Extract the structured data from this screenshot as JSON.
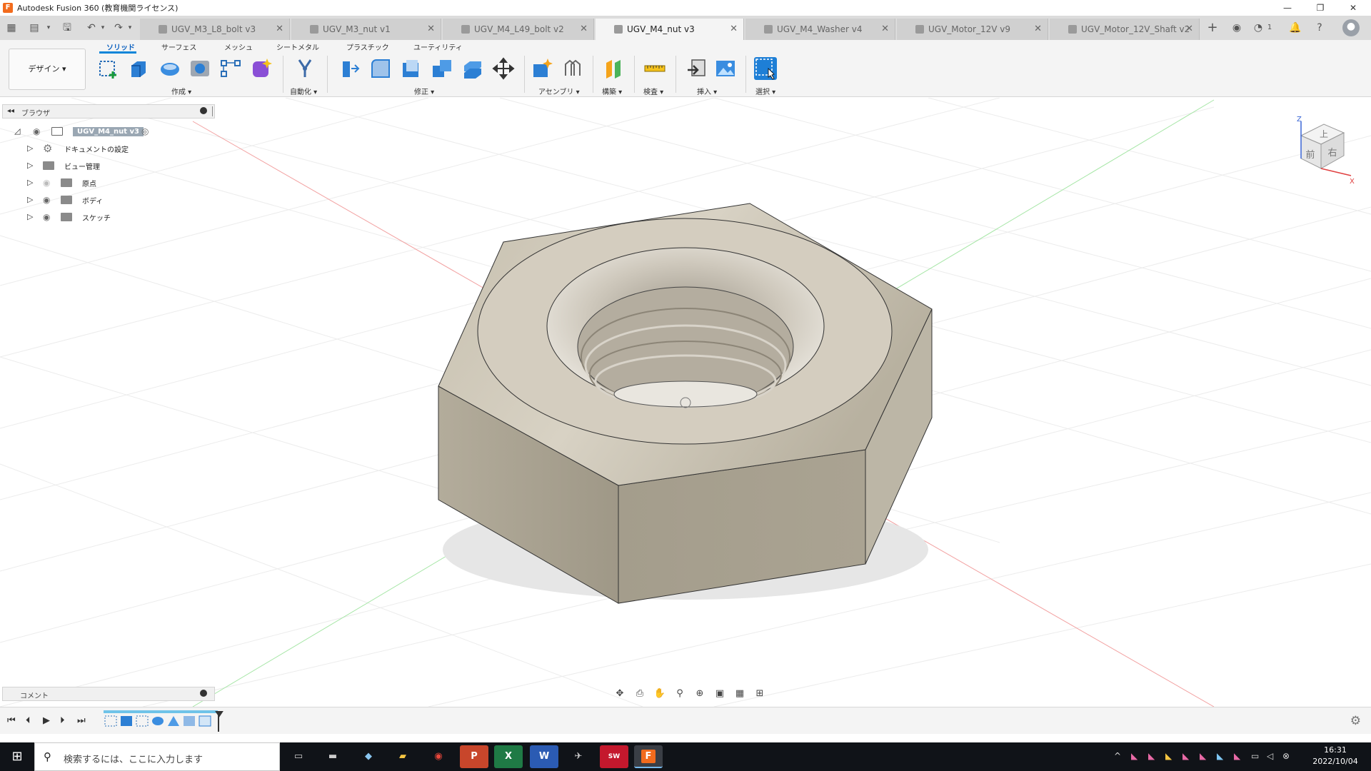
{
  "window": {
    "title": "Autodesk Fusion 360 (教育機関ライセンス)",
    "minimize": "—",
    "restore": "❐",
    "close": "✕"
  },
  "tabs": [
    {
      "label": "UGV_M3_L8_bolt v3",
      "active": false
    },
    {
      "label": "UGV_M3_nut v1",
      "active": false
    },
    {
      "label": "UGV_M4_L49_bolt v2",
      "active": false
    },
    {
      "label": "UGV_M4_nut v3",
      "active": true
    },
    {
      "label": "UGV_M4_Washer v4",
      "active": false
    },
    {
      "label": "UGV_Motor_12V v9",
      "active": false
    },
    {
      "label": "UGV_Motor_12V_Shaft v2",
      "active": false
    }
  ],
  "tabbar_right": {
    "job_count": "1"
  },
  "ribbon": {
    "workspace": "デザイン",
    "tabs": [
      "ソリッド",
      "サーフェス",
      "メッシュ",
      "シートメタル",
      "プラスチック",
      "ユーティリティ"
    ],
    "groups": [
      "作成",
      "自動化",
      "修正",
      "アセンブリ",
      "構築",
      "検査",
      "挿入",
      "選択"
    ]
  },
  "browser": {
    "header": "ブラウザ",
    "root": "UGV_M4_nut v3",
    "items": [
      "ドキュメントの設定",
      "ビュー管理",
      "原点",
      "ボディ",
      "スケッチ"
    ]
  },
  "viewcube": {
    "top": "上",
    "front": "前",
    "right": "右",
    "axis_z": "Z",
    "axis_x": "X"
  },
  "comments": {
    "label": "コメント"
  },
  "taskbar": {
    "search_placeholder": "検索するには、ここに入力します",
    "apps": [
      "Files",
      "Terminal",
      "Edit",
      "Explorer",
      "Chrome",
      "P",
      "X",
      "W",
      "Tools",
      "SW 2019",
      "F"
    ],
    "time": "16:31",
    "date": "2022/10/04"
  },
  "colors": {
    "accent": "#0a85d9",
    "fusion_orange": "#f26b1d",
    "model": "#c9c2b2"
  }
}
